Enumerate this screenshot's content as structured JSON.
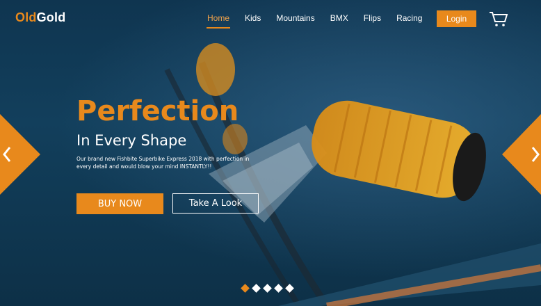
{
  "brand": {
    "prefix": "Old",
    "suffix": "Gold",
    "accent_color": "#e8891c"
  },
  "nav": {
    "items": [
      {
        "label": "Home",
        "active": true
      },
      {
        "label": "Kids"
      },
      {
        "label": "Mountains"
      },
      {
        "label": "BMX"
      },
      {
        "label": "Flips"
      },
      {
        "label": "Racing"
      }
    ],
    "login_label": "Login",
    "cart_icon": "cart-icon"
  },
  "hero": {
    "headline": "Perfection",
    "subheadline": "In Every Shape",
    "description": "Our brand new Fishbite Superbike Express 2018 with perfection in every detail and would blow your mind INSTANTLY!!",
    "primary_cta": "BUY NOW",
    "secondary_cta": "Take A Look"
  },
  "slider": {
    "slide_count": 5,
    "active_index": 0,
    "prev_icon": "chevron-left-icon",
    "next_icon": "chevron-right-icon"
  }
}
